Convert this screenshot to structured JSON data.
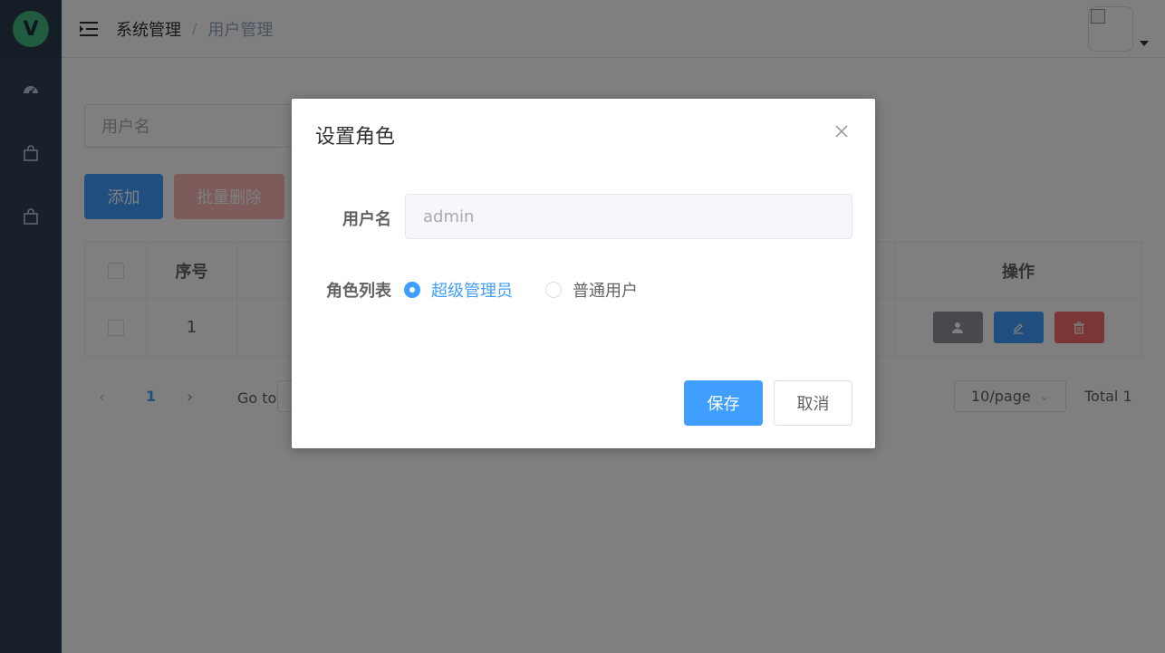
{
  "logo": {
    "letter": "V"
  },
  "header": {
    "breadcrumb": [
      "系统管理",
      "用户管理"
    ],
    "separator": "/"
  },
  "sidebar": {
    "items": [
      {
        "icon": "dashboard-icon"
      },
      {
        "icon": "shopping-bag-icon"
      },
      {
        "icon": "shopping-bag-icon"
      }
    ]
  },
  "toolbar": {
    "search_placeholder": "用户名",
    "add_label": "添加",
    "batch_delete_label": "批量删除"
  },
  "table": {
    "headers": {
      "index": "序号",
      "ops": "操作"
    },
    "rows": [
      {
        "index": "1"
      }
    ]
  },
  "pagination": {
    "prev": "‹",
    "current": "1",
    "next": "›",
    "goto_label": "Go to",
    "page_size": "10/page",
    "total": "Total 1"
  },
  "dialog": {
    "title": "设置角色",
    "username_label": "用户名",
    "username_value": "admin",
    "roles_label": "角色列表",
    "roles": [
      {
        "label": "超级管理员",
        "selected": true
      },
      {
        "label": "普通用户",
        "selected": false
      }
    ],
    "save_label": "保存",
    "cancel_label": "取消"
  },
  "colors": {
    "primary": "#409eff",
    "danger": "#f56c6c",
    "sidebar": "#304156"
  }
}
